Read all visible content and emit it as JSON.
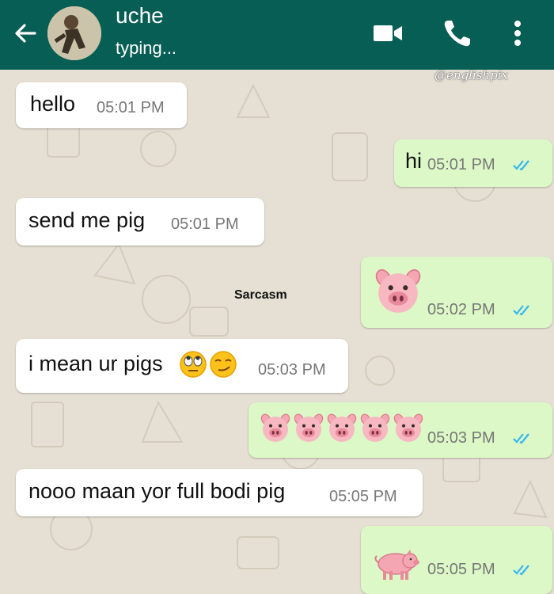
{
  "header": {
    "contact_name": "uche",
    "status": "typing..."
  },
  "watermark": "@englishpix",
  "overlay_caption": "Sarcasm",
  "colors": {
    "header": "#075e54",
    "incoming_bubble": "#ffffff",
    "outgoing_bubble": "#dcf8c6",
    "read_ticks": "#34b7f1",
    "wallpaper": "#e6e0d4"
  },
  "icons": [
    "back-arrow-icon",
    "video-call-icon",
    "voice-call-icon",
    "more-options-icon",
    "double-check-read-icon",
    "pig-face-emoji",
    "pig-emoji",
    "rolling-eyes-emoji",
    "smirk-emoji"
  ],
  "messages": [
    {
      "direction": "incoming",
      "text": "hello",
      "time": "05:01 PM"
    },
    {
      "direction": "outgoing",
      "text": "hi",
      "time": "05:01 PM",
      "read": true
    },
    {
      "direction": "incoming",
      "text": "send me pig",
      "time": "05:01 PM"
    },
    {
      "direction": "outgoing",
      "emoji": "pig-face-emoji",
      "emoji_count": 1,
      "time": "05:02 PM",
      "read": true
    },
    {
      "direction": "incoming",
      "text": "i mean ur pigs",
      "emoji_after": [
        "rolling-eyes-emoji",
        "smirk-emoji"
      ],
      "time": "05:03 PM"
    },
    {
      "direction": "outgoing",
      "emoji": "pig-face-emoji",
      "emoji_count": 5,
      "time": "05:03 PM",
      "read": true
    },
    {
      "direction": "incoming",
      "text": "nooo maan yor full bodi pig",
      "time": "05:05 PM"
    },
    {
      "direction": "outgoing",
      "emoji": "pig-emoji",
      "emoji_count": 1,
      "time": "05:05 PM",
      "read": true
    }
  ]
}
